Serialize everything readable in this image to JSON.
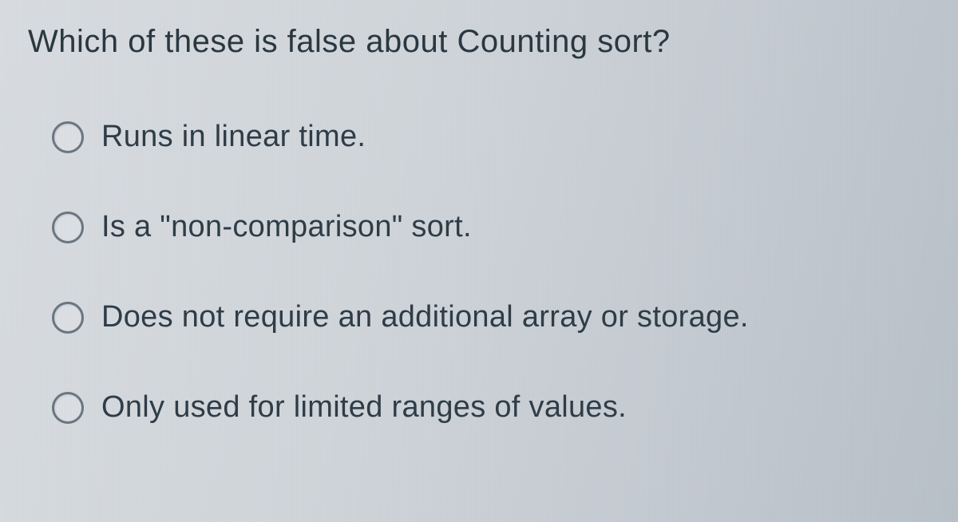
{
  "question": {
    "text": "Which of these is false about Counting sort?"
  },
  "options": [
    {
      "label": "Runs in linear time."
    },
    {
      "label": "Is a \"non-comparison\" sort."
    },
    {
      "label": "Does not require an additional array or storage."
    },
    {
      "label": "Only used for limited ranges of values."
    }
  ]
}
